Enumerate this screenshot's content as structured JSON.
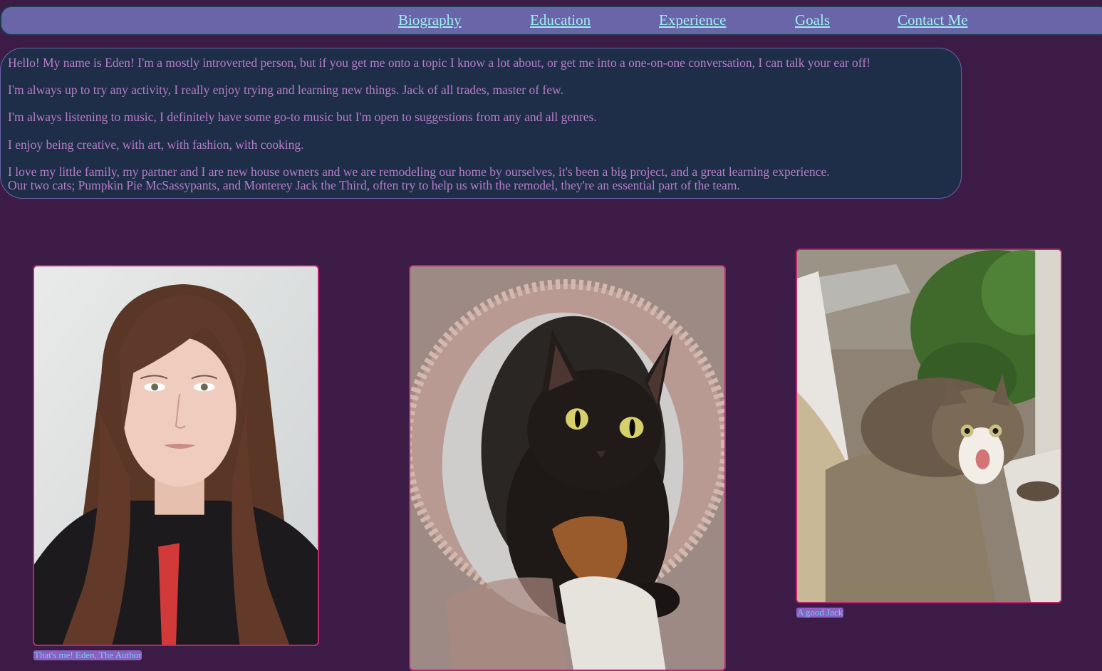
{
  "nav": {
    "items": [
      {
        "label": "Biography"
      },
      {
        "label": "Education"
      },
      {
        "label": "Experience"
      },
      {
        "label": "Goals"
      },
      {
        "label": "Contact Me"
      }
    ]
  },
  "bio": {
    "paragraphs": [
      "Hello! My name is Eden! I'm a mostly introverted person, but if you get me onto a topic I know a lot about, or get me into a one-on-one conversation, I can talk your ear off!",
      "I'm always up to try any activity, I really enjoy trying and learning new things. Jack of all trades, master of few.",
      "I'm always listening to music, I definitely have some go-to music but I'm open to suggestions from any and all genres.",
      "I enjoy being creative, with art, with fashion, with cooking.",
      "I love my little family, my partner and I are new house owners and we are remodeling our home by ourselves, it's been a big project, and a great learning experience.",
      "Our two cats; Pumpkin Pie McSassypants, and Monterey Jack the Third, often try to help us with the remodel, they're an essential part of the team."
    ]
  },
  "gallery": {
    "items": [
      {
        "caption": "That's me! Eden, The Author"
      },
      {
        "caption": ""
      },
      {
        "caption": "A good Jack"
      }
    ]
  },
  "colors": {
    "page_background": "#3d1b47",
    "nav_background": "#6a64a8",
    "nav_link": "#9ff0f0",
    "bio_background": "#1e2d48",
    "bio_text": "#b77ec8",
    "photo_border": "#c2236e",
    "caption_background": "#8a60c2",
    "caption_text": "#6fd0e8"
  }
}
